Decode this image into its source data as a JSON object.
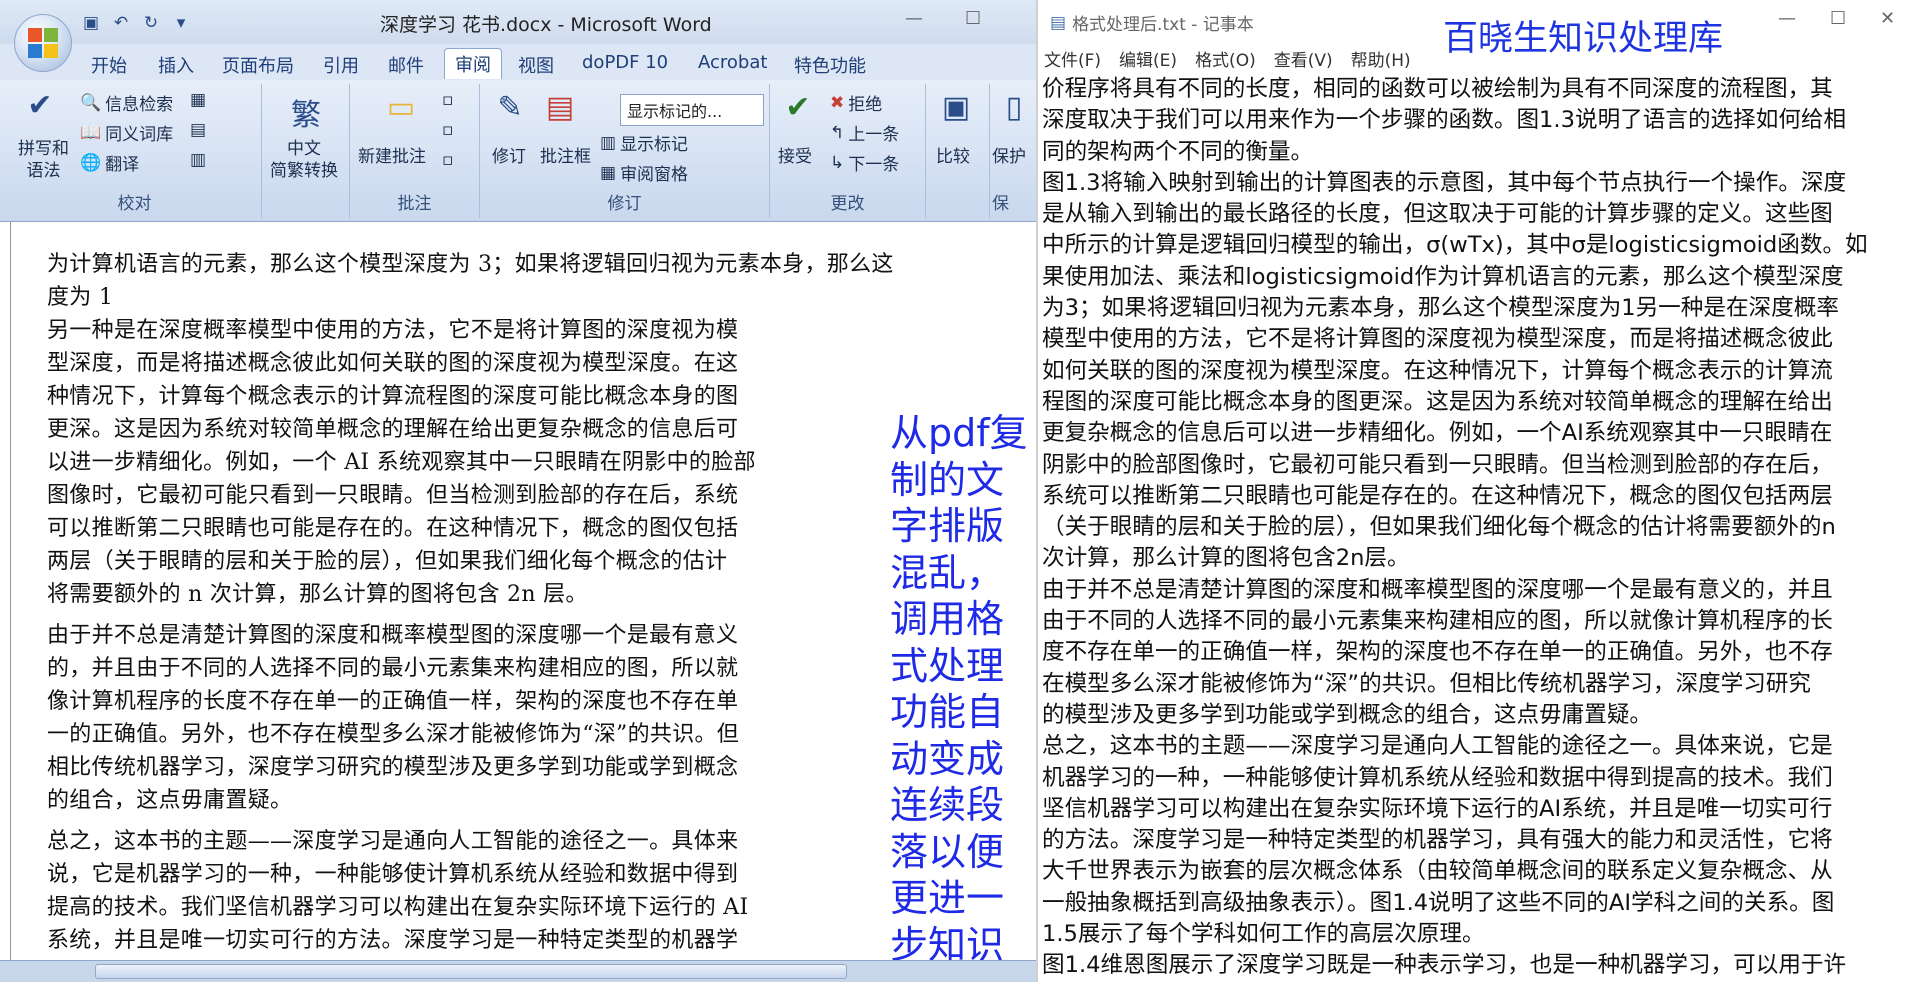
{
  "word": {
    "title": "深度学习 花书.docx - Microsoft Word",
    "tabs": [
      "开始",
      "插入",
      "页面布局",
      "引用",
      "邮件",
      "审阅",
      "视图",
      "doPDF 10",
      "Acrobat",
      "特色功能"
    ],
    "groups": {
      "proofing": "校对",
      "chinese": "",
      "comments": "批注",
      "tracking": "修订",
      "changes": "更改"
    },
    "buttons": {
      "spelling": "拼写和\n语法",
      "research": "信息检索",
      "thesaurus": "同义词库",
      "translate": "翻译",
      "convert": "中文\n简繁转换",
      "new_comment": "新建批注",
      "track": "修订",
      "balloons": "批注框",
      "show_markup_select": "显示标记的...",
      "show_markup": "显示标记",
      "review_pane": "审阅窗格",
      "accept": "接受",
      "reject": "拒绝",
      "previous": "上一条",
      "next": "下一条",
      "compare": "比较",
      "protect": "保护",
      "protect_group": "保"
    },
    "doc_lines": [
      "为计算机语言的元素，那么这个模型深度为 3；如果将逻辑回归视为元素本身，那么这",
      "度为 1",
      "另一种是在深度概率模型中使用的方法，它不是将计算图的深度视为模",
      "型深度，而是将描述概念彼此如何关联的图的深度视为模型深度。在这",
      "种情况下，计算每个概念表示的计算流程图的深度可能比概念本身的图",
      "更深。这是因为系统对较简单概念的理解在给出更复杂概念的信息后可",
      "以进一步精细化。例如，一个 AI 系统观察其中一只眼睛在阴影中的脸部",
      "图像时，它最初可能只看到一只眼睛。但当检测到脸部的存在后，系统",
      "可以推断第二只眼睛也可能是存在的。在这种情况下，概念的图仅包括",
      "两层（关于眼睛的层和关于脸的层），但如果我们细化每个概念的估计",
      "将需要额外的 n 次计算，那么计算的图将包含 2n 层。",
      "由于并不总是清楚计算图的深度和概率模型图的深度哪一个是最有意义",
      "的，并且由于不同的人选择不同的最小元素集来构建相应的图，所以就",
      "像计算机程序的长度不存在单一的正确值一样，架构的深度也不存在单",
      "一的正确值。另外，也不存在模型多么深才能被修饰为“深”的共识。但",
      "相比传统机器学习，深度学习研究的模型涉及更多学到功能或学到概念",
      "的组合，这点毋庸置疑。",
      "总之，这本书的主题——深度学习是通向人工智能的途径之一。具体来",
      "说，它是机器学习的一种，一种能够使计算机系统从经验和数据中得到",
      "提高的技术。我们坚信机器学习可以构建出在复杂实际环境下运行的 AI",
      "系统，并且是唯一切实可行的方法。深度学习是一种特定类型的机器学"
    ],
    "note": "从pdf复制的文字排版混乱，调用格式处理功能自动变成连续段落以便更进一步知识处理"
  },
  "notepad": {
    "title": "格式处理后.txt - 记事本",
    "brand": "百晓生知识处理库",
    "menu": [
      "文件(F)",
      "编辑(E)",
      "格式(O)",
      "查看(V)",
      "帮助(H)"
    ],
    "lines": [
      "价程序将具有不同的长度，相同的函数可以被绘制为具有不同深度的流程图，其",
      "深度取决于我们可以用来作为一个步骤的函数。图1.3说明了语言的选择如何给相",
      "同的架构两个不同的衡量。",
      "图1.3将输入映射到输出的计算图表的示意图，其中每个节点执行一个操作。深度",
      "是从输入到输出的最长路径的长度，但这取决于可能的计算步骤的定义。这些图",
      "中所示的计算是逻辑回归模型的输出，σ(wTx)，其中σ是logisticsigmoid函数。如",
      "果使用加法、乘法和logisticsigmoid作为计算机语言的元素，那么这个模型深度",
      "为3；如果将逻辑回归视为元素本身，那么这个模型深度为1另一种是在深度概率",
      "模型中使用的方法，它不是将计算图的深度视为模型深度，而是将描述概念彼此",
      "如何关联的图的深度视为模型深度。在这种情况下，计算每个概念表示的计算流",
      "程图的深度可能比概念本身的图更深。这是因为系统对较简单概念的理解在给出",
      "更复杂概念的信息后可以进一步精细化。例如，一个AI系统观察其中一只眼睛在",
      "阴影中的脸部图像时，它最初可能只看到一只眼睛。但当检测到脸部的存在后，",
      "系统可以推断第二只眼睛也可能是存在的。在这种情况下，概念的图仅包括两层",
      "（关于眼睛的层和关于脸的层），但如果我们细化每个概念的估计将需要额外的n",
      "次计算，那么计算的图将包含2n层。",
      "由于并不总是清楚计算图的深度和概率模型图的深度哪一个是最有意义的，并且",
      "由于不同的人选择不同的最小元素集来构建相应的图，所以就像计算机程序的长",
      "度不存在单一的正确值一样，架构的深度也不存在单一的正确值。另外，也不存",
      "在模型多么深才能被修饰为“深”的共识。但相比传统机器学习，深度学习研究",
      "的模型涉及更多学到功能或学到概念的组合，这点毋庸置疑。",
      "总之，这本书的主题——深度学习是通向人工智能的途径之一。具体来说，它是",
      "机器学习的一种，一种能够使计算机系统从经验和数据中得到提高的技术。我们",
      "坚信机器学习可以构建出在复杂实际环境下运行的AI系统，并且是唯一切实可行",
      "的方法。深度学习是一种特定类型的机器学习，具有强大的能力和灵活性，它将",
      "大千世界表示为嵌套的层次概念体系（由较简单概念间的联系定义复杂概念、从",
      "一般抽象概括到高级抽象表示）。图1.4说明了这些不同的AI学科之间的关系。图",
      "1.5展示了每个学科如何工作的高层次原理。",
      "图1.4维恩图展示了深度学习既是一种表示学习，也是一种机器学习，可以用于许"
    ]
  }
}
